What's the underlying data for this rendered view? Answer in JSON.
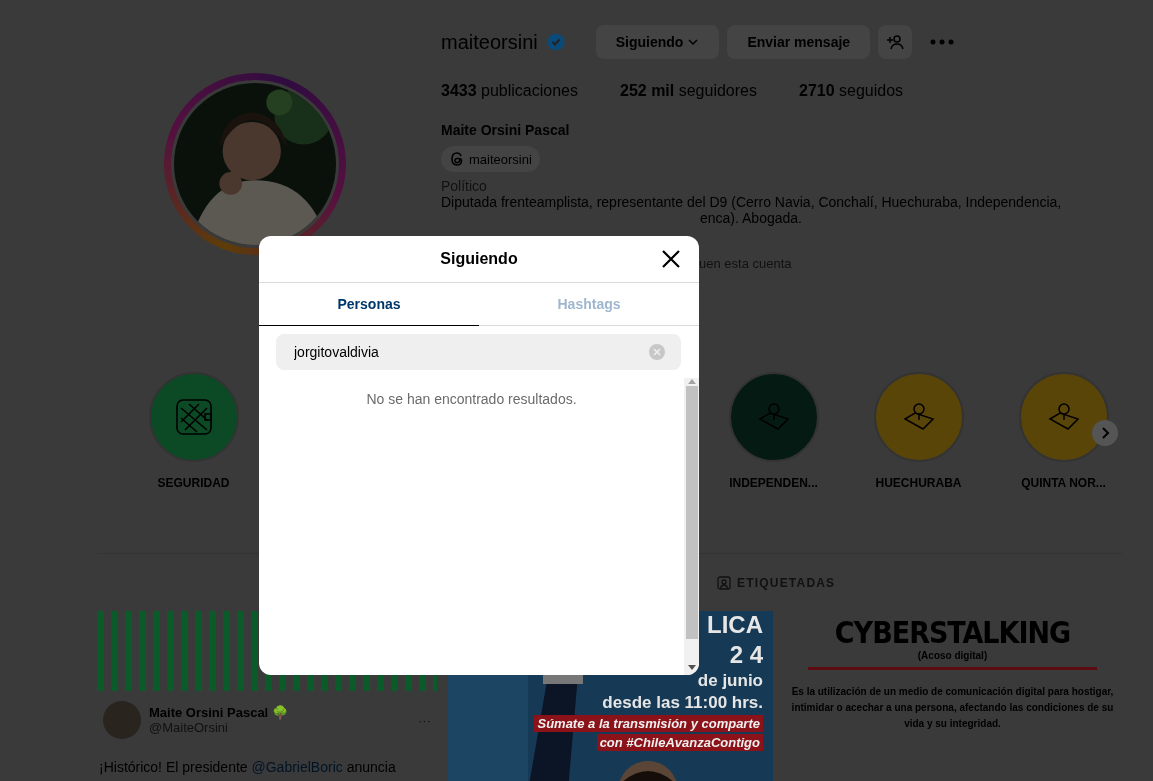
{
  "profile": {
    "username": "maiteorsini",
    "verified": true,
    "buttons": [
      {
        "kind": "dropdown",
        "label": "Siguiendo"
      },
      {
        "kind": "plain",
        "label": "Enviar mensaje"
      },
      {
        "kind": "add-user"
      },
      {
        "kind": "more"
      }
    ],
    "stats": [
      {
        "value": "3433",
        "label": "publicaciones"
      },
      {
        "value": "252 mil",
        "label": "seguidores"
      },
      {
        "value": "2710",
        "label": "seguidos"
      }
    ],
    "full_name": "Maite Orsini Pascal",
    "threads_handle": "maiteorsini",
    "category": "Político",
    "bio_line": "Diputada frenteamplista, representante del D9 (Cerro Navia, Conchalí, Huechuraba, Independencia,",
    "bio_fragment": "enca). Abogada.",
    "followed_by_fragment": "uen esta cuenta"
  },
  "highlights": [
    {
      "label": "SEGURIDAD",
      "color": "#0c4a26"
    },
    {
      "label": "INDEPENDEN...",
      "color": "#061a14"
    },
    {
      "label": "HUECHURABA",
      "color": "#5a4508"
    },
    {
      "label": "QUINTA NOR...",
      "color": "#5a4508"
    }
  ],
  "profile_tab": {
    "label": "ETIQUETADAS"
  },
  "posts": [
    {
      "kind": "tweet",
      "name": "Maite Orsini Pascal 🌳",
      "handle": "@MaiteOrsini",
      "more": "···",
      "text_before": "¡Histórico! El presidente ",
      "mention": "@GabrielBoric",
      "text_after": " anuncia"
    },
    {
      "kind": "poster",
      "lines": [
        "LICA",
        "2 4",
        "de junio",
        "desde las 11:00 hrs."
      ],
      "highlights": [
        "Súmate a la transmisión y comparte",
        "con #ChileAvanzaContigo"
      ]
    },
    {
      "kind": "info",
      "title": "CYBERSTALKING",
      "subtitle": "(Acoso digital)",
      "text": "Es la utilización de un medio de comunicación digital para hostigar, intimidar o acechar a una persona, afectando las condiciones de su vida y su integridad."
    }
  ],
  "modal": {
    "title": "Siguiendo",
    "tabs": [
      {
        "label": "Personas",
        "selected": true
      },
      {
        "label": "Hashtags",
        "selected": false
      }
    ],
    "search": {
      "value": "jorgitovaldivia"
    },
    "empty_message": "No se han encontrado resultados."
  }
}
